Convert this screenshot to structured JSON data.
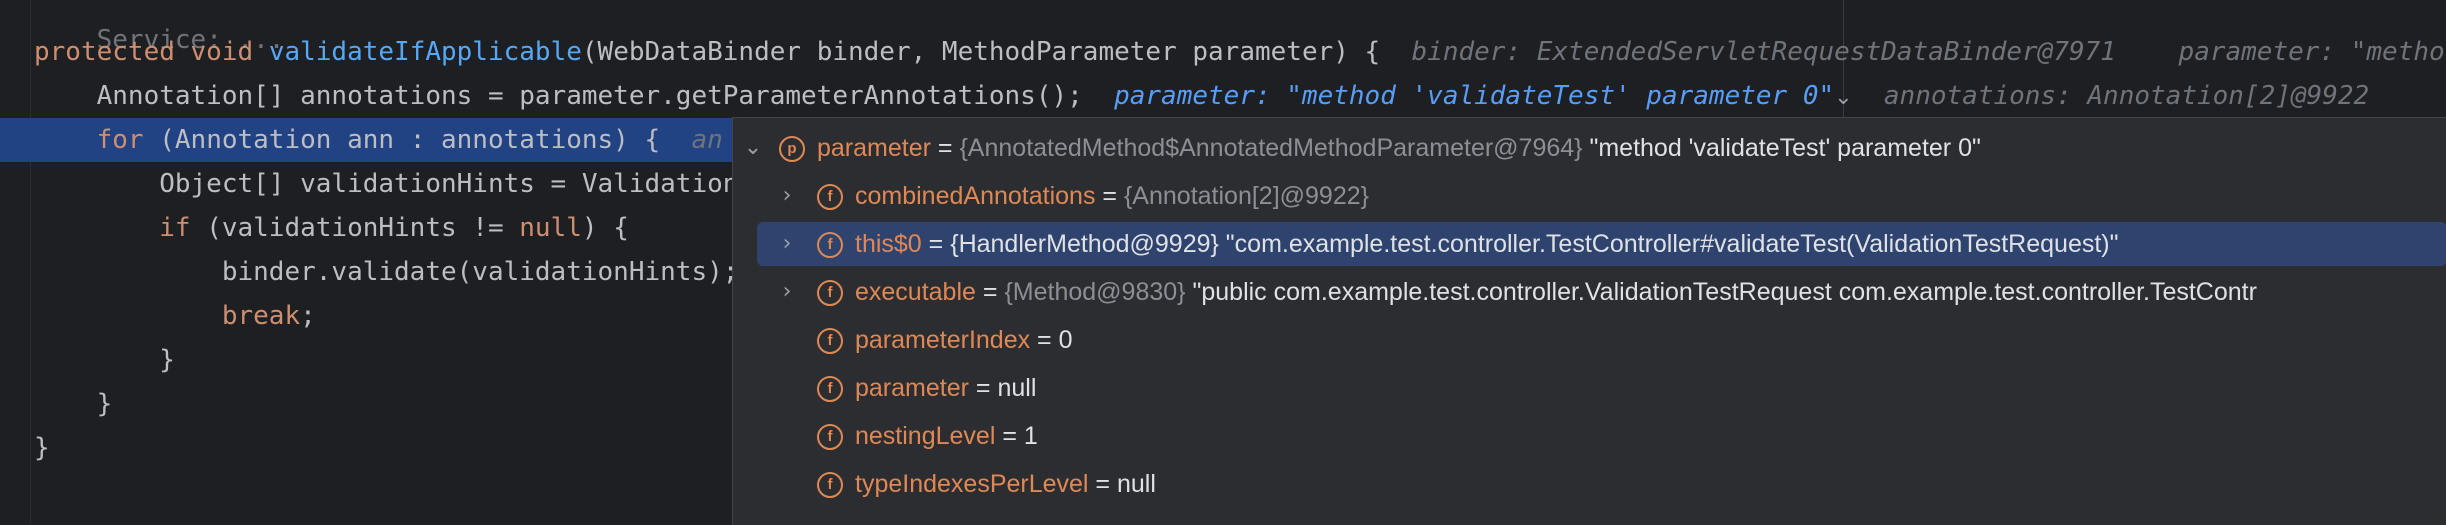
{
  "editor": {
    "top_cut_text": "Service: ...",
    "lines": [
      {
        "tokens": [
          {
            "t": "protected void ",
            "c": "kw"
          },
          {
            "t": "validateIfApplicable",
            "c": "fn"
          },
          {
            "t": "(WebDataBinder binder, MethodParameter parameter) {  ",
            "c": "txt"
          },
          {
            "t": "binder: ExtendedServletRequestDataBinder@7971    parameter: \"metho",
            "c": "hint"
          }
        ]
      },
      {
        "tokens": [
          {
            "t": "    Annotation[] annotations = parameter.getParameterAnnotations();  ",
            "c": "txt"
          },
          {
            "t": "parameter: \"method 'validateTest' parameter 0\"",
            "c": "hint-blue"
          },
          {
            "t": "⌄",
            "c": "chev"
          },
          {
            "t": "  annotations: Annotation[2]@9922",
            "c": "hint"
          }
        ]
      },
      {
        "highlight": true,
        "tokens": [
          {
            "t": "    for ",
            "c": "kw"
          },
          {
            "t": "(Annotation ann : annotations) {  ",
            "c": "txt"
          },
          {
            "t": "an",
            "c": "hint"
          }
        ]
      },
      {
        "tokens": [
          {
            "t": "        Object[] validationHints = Validation",
            "c": "txt"
          }
        ]
      },
      {
        "tokens": [
          {
            "t": "        if ",
            "c": "kw"
          },
          {
            "t": "(validationHints != ",
            "c": "txt"
          },
          {
            "t": "null",
            "c": "kw"
          },
          {
            "t": ") {",
            "c": "txt"
          }
        ]
      },
      {
        "tokens": [
          {
            "t": "            binder.validate(validationHints);",
            "c": "txt"
          }
        ]
      },
      {
        "tokens": [
          {
            "t": "            break",
            "c": "kw"
          },
          {
            "t": ";",
            "c": "txt"
          }
        ]
      },
      {
        "tokens": [
          {
            "t": "        }",
            "c": "txt"
          }
        ]
      },
      {
        "tokens": [
          {
            "t": "    }",
            "c": "txt"
          }
        ]
      },
      {
        "tokens": [
          {
            "t": "}",
            "c": "txt"
          }
        ]
      }
    ]
  },
  "debug_popup": {
    "root": {
      "expander": "⌄",
      "badge": "p",
      "name": "parameter",
      "eq": " = ",
      "type": "{AnnotatedMethod$AnnotatedMethodParameter@7964}",
      "value": " \"method 'validateTest' parameter 0\""
    },
    "rows": [
      {
        "expander": "›",
        "badge": "f",
        "name": "combinedAnnotations",
        "eq": " = ",
        "type": "{Annotation[2]@9922}",
        "value": "",
        "selected": false
      },
      {
        "expander": "›",
        "badge": "f",
        "name": "this$0",
        "eq": " = ",
        "type": "",
        "value": "{HandlerMethod@9929} \"com.example.test.controller.TestController#validateTest(ValidationTestRequest)\"",
        "selected": true
      },
      {
        "expander": "›",
        "badge": "f",
        "name": "executable",
        "eq": " = ",
        "type": "{Method@9830}",
        "value": " \"public com.example.test.controller.ValidationTestRequest com.example.test.controller.TestContr",
        "selected": false
      },
      {
        "expander": "",
        "badge": "f",
        "name": "parameterIndex",
        "eq": " = ",
        "type": "",
        "value": "0",
        "selected": false
      },
      {
        "expander": "",
        "badge": "f",
        "name": "parameter",
        "eq": " = ",
        "type": "",
        "value": "null",
        "selected": false
      },
      {
        "expander": "",
        "badge": "f",
        "name": "nestingLevel",
        "eq": " = ",
        "type": "",
        "value": "1",
        "selected": false
      },
      {
        "expander": "",
        "badge": "f",
        "name": "typeIndexesPerLevel",
        "eq": " = ",
        "type": "",
        "value": "null",
        "selected": false
      }
    ]
  }
}
